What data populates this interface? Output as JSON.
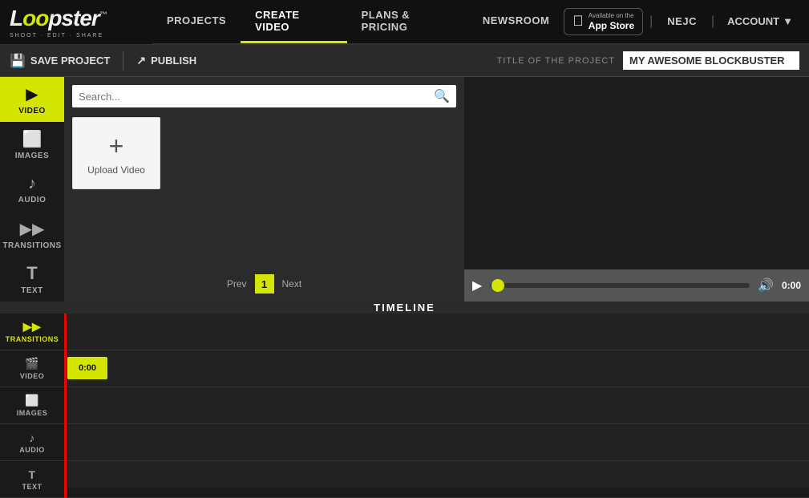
{
  "logo": {
    "brand": "Loopster",
    "tagline": "SHOOT · EDIT · SHARE"
  },
  "nav": {
    "links": [
      {
        "label": "PROJECTS",
        "active": false
      },
      {
        "label": "CREATE VIDEO",
        "active": true
      },
      {
        "label": "PLANS & PRICING",
        "active": false
      },
      {
        "label": "NEWSROOM",
        "active": false
      }
    ],
    "appStore": {
      "smallText": "Available on the",
      "bigText": "App Store"
    },
    "user": "NEJC",
    "account": "ACCOUNT"
  },
  "toolbar": {
    "saveLabel": "SAVE PROJECT",
    "publishLabel": "PUBLISH",
    "titleLabel": "TITLE OF THE PROJECT",
    "projectTitle": "MY AWESOME BLOCKBUSTER"
  },
  "sidebar": {
    "tools": [
      {
        "label": "VIDEO",
        "icon": "🎬",
        "active": true
      },
      {
        "label": "IMAGES",
        "icon": "🖼",
        "active": false
      },
      {
        "label": "AUDIO",
        "icon": "🎵",
        "active": false
      },
      {
        "label": "TRANSITIONS",
        "icon": "⏩",
        "active": false
      },
      {
        "label": "TEXT",
        "icon": "T",
        "active": false
      }
    ]
  },
  "mediaPanel": {
    "searchPlaceholder": "Search...",
    "uploadLabel": "Upload Video",
    "pagination": {
      "prev": "Prev",
      "current": "1",
      "next": "Next"
    }
  },
  "timeline": {
    "title": "TIMELINE",
    "tracks": [
      {
        "label": "TRANSITIONS",
        "icon": "⏩"
      },
      {
        "label": "VIDEO",
        "icon": "🎬"
      },
      {
        "label": "IMAGES",
        "icon": "🖼"
      },
      {
        "label": "AUDIO",
        "icon": "🎵"
      },
      {
        "label": "TEXT",
        "icon": "T"
      }
    ],
    "timeBlock": "0:00"
  },
  "playback": {
    "time": "0:00"
  }
}
